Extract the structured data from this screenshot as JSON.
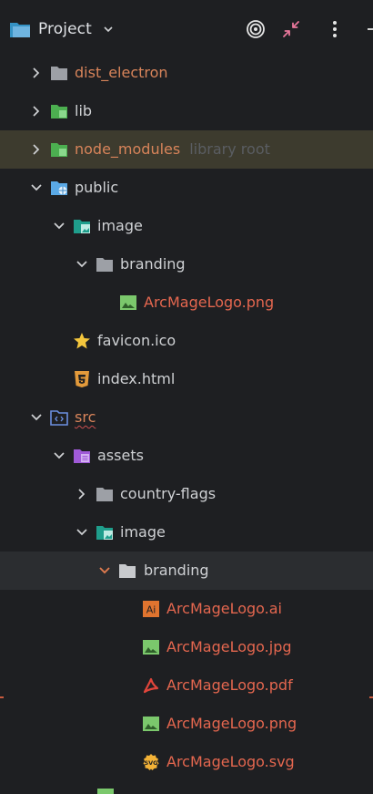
{
  "header": {
    "title": "Project",
    "buttons": [
      "target-icon",
      "collapse-icon",
      "more-icon"
    ]
  },
  "tree": {
    "rows": [
      {
        "label": "dist_electron",
        "icon": "folder-icon",
        "arrow": "right"
      },
      {
        "label": "lib",
        "icon": "folder-lib-icon",
        "arrow": "right"
      },
      {
        "label": "node_modules",
        "suffix": "library root",
        "icon": "folder-lib-icon",
        "arrow": "right"
      },
      {
        "label": "public",
        "icon": "folder-web-icon",
        "arrow": "down"
      },
      {
        "label": "image",
        "icon": "folder-image-icon",
        "arrow": "down"
      },
      {
        "label": "branding",
        "icon": "folder-icon",
        "arrow": "down"
      },
      {
        "label": "ArcMageLogo.png",
        "icon": "png-icon"
      },
      {
        "label": "favicon.ico",
        "icon": "star-icon"
      },
      {
        "label": "index.html",
        "icon": "html5-icon"
      },
      {
        "label": "src",
        "icon": "folder-src-icon",
        "arrow": "down"
      },
      {
        "label": "assets",
        "icon": "folder-assets-icon",
        "arrow": "down"
      },
      {
        "label": "country-flags",
        "icon": "folder-icon",
        "arrow": "right"
      },
      {
        "label": "image",
        "icon": "folder-image-icon",
        "arrow": "down"
      },
      {
        "label": "branding",
        "icon": "folder-icon",
        "arrow": "down"
      },
      {
        "label": "ArcMageLogo.ai",
        "icon": "ai-icon"
      },
      {
        "label": "ArcMageLogo.jpg",
        "icon": "jpg-icon"
      },
      {
        "label": "ArcMageLogo.pdf",
        "icon": "pdf-icon"
      },
      {
        "label": "ArcMageLogo.png",
        "icon": "png-icon"
      },
      {
        "label": "ArcMageLogo.svg",
        "icon": "svg-icon"
      }
    ]
  },
  "colors": {
    "background": "#1e1f22",
    "selected_row": "#2b2d30",
    "library_row": "#3d3b2e",
    "ignored_text": "#d8845a",
    "error_text": "#e5674f",
    "folder_gray": "#9da0a6",
    "folder_blue": "#5aa9e6",
    "folder_green": "#4caf50",
    "folder_teal": "#1f9e8c",
    "folder_purple": "#a05ad8",
    "image_green": "#7bc86c"
  }
}
